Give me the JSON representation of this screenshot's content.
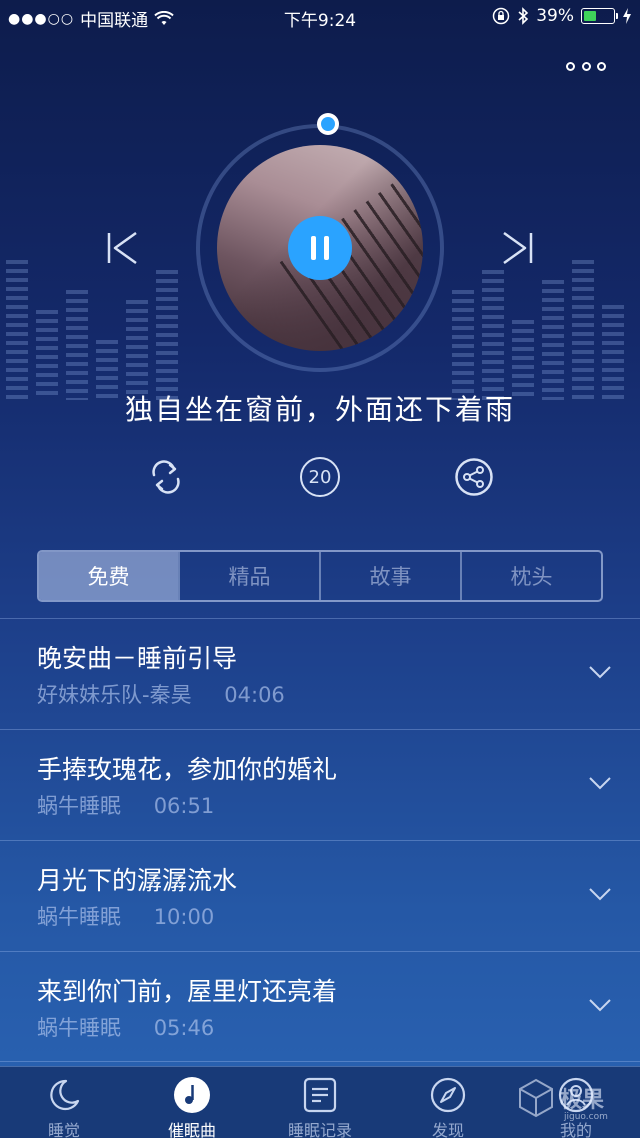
{
  "status_bar": {
    "signal": "●●●○○",
    "carrier": "中国联通",
    "time": "下午9:24",
    "battery_percent": "39%",
    "battery_level": 0.39
  },
  "player": {
    "song_title": "独自坐在窗前，外面还下着雨",
    "timer_value": "20",
    "accent_color": "#2aa3ff"
  },
  "tabs": [
    "免费",
    "精品",
    "故事",
    "枕头"
  ],
  "active_tab": 0,
  "songs": [
    {
      "title": "晚安曲－睡前引导",
      "artist": "好妹妹乐队-秦昊",
      "duration": "04:06"
    },
    {
      "title": "手捧玫瑰花，参加你的婚礼",
      "artist": "蜗牛睡眠",
      "duration": "06:51"
    },
    {
      "title": "月光下的潺潺流水",
      "artist": "蜗牛睡眠",
      "duration": "10:00"
    },
    {
      "title": "来到你门前，屋里灯还亮着",
      "artist": "蜗牛睡眠",
      "duration": "05:46"
    }
  ],
  "nav": [
    {
      "label": "睡觉",
      "icon": "moon-icon"
    },
    {
      "label": "催眠曲",
      "icon": "music-note-icon"
    },
    {
      "label": "睡眠记录",
      "icon": "record-list-icon"
    },
    {
      "label": "发现",
      "icon": "compass-icon"
    },
    {
      "label": "我的",
      "icon": "user-icon"
    }
  ],
  "watermark": {
    "text": "极果",
    "small": "jiguo.com"
  }
}
